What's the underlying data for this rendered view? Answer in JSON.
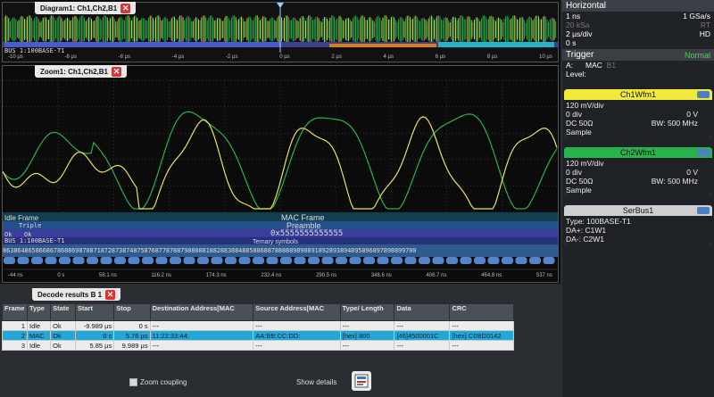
{
  "diagram1": {
    "title": "Diagram1: Ch1,Ch2,B1",
    "bus_label": "BUS 1:100BASE-T1",
    "ticks": [
      "-10 µs",
      "-8 µs",
      "-6 µs",
      "-4 µs",
      "-2 µs",
      "0 µs",
      "2 µs",
      "4 µs",
      "6 µs",
      "8 µs",
      "10 µs"
    ]
  },
  "zoom1": {
    "title": "Zoom1: Ch1,Ch2,B1",
    "frame_idle": "Idle Frame",
    "triple": "Triple",
    "ok1": "Ok",
    "ok2": "Ok",
    "mac_frame": "MAC Frame",
    "preamble": "Preamble",
    "preamble_value": "0x5555555555555",
    "bus_label": "BUS 1:100BASE-T1",
    "ternary": "Ternary symbols",
    "ternary_row": "863864865866867868869870871872873874875876877878879880881882883884885886887888889890891892893894895896897898899700",
    "ticks": [
      "-44 ns",
      "0 s",
      "58.1 ns",
      "116.2 ns",
      "174.3 ns",
      "232.4 ns",
      "290.5 ns",
      "348.6 ns",
      "406.7 ns",
      "464.8 ns",
      "537 ns"
    ]
  },
  "decode": {
    "title": "Decode results B 1",
    "headers": [
      "Frame",
      "Type",
      "State",
      "Start",
      "Stop",
      "Destination Address[MAC",
      "Source Address[MAC",
      "Type/ Length",
      "Data",
      "CRC"
    ],
    "rows": [
      [
        "1",
        "Idle",
        "Ok",
        "-9.989 µs",
        "0 s",
        "---",
        "---",
        "---",
        "---",
        "---"
      ],
      [
        "2",
        "MAC",
        "Ok",
        "0 s",
        "5.76 µs",
        "11:22:33:44:",
        "AA:BB:CC:DD:",
        "[hex] 800",
        "[46]4500001C",
        "[hex] C0BD0142"
      ],
      [
        "3",
        "Idle",
        "Ok",
        "5.85 µs",
        "9.989 µs",
        "---",
        "---",
        "---",
        "---",
        "---"
      ]
    ],
    "zoom_coupling": "Zoom coupling",
    "show_details": "Show details"
  },
  "horizontal": {
    "title": "Horizontal",
    "rows": [
      {
        "left": "1 ns",
        "right": "1 GSa/s",
        "dim": false
      },
      {
        "left": "20 kSa",
        "right": "RT",
        "dim": true
      },
      {
        "left": "2 µs/div",
        "right": "HD",
        "dim": false
      },
      {
        "left": "0 s",
        "right": "",
        "dim": false
      }
    ]
  },
  "trigger": {
    "title": "Trigger",
    "mode": "Normal",
    "a_label": "A:",
    "a_type": "MAC",
    "a_src": "B1",
    "level_label": "Level:"
  },
  "ch1": {
    "title": "Ch1Wfm1",
    "scale": "120 mV/div",
    "offset": "0 div",
    "volt": "0 V",
    "coupling": "DC 50Ω",
    "bw": "BW: 500 MHz",
    "mode": "Sample",
    "color": "#f2ea3a"
  },
  "ch2": {
    "title": "Ch2Wfm1",
    "scale": "120 mV/div",
    "offset": "0 div",
    "volt": "0 V",
    "coupling": "DC 50Ω",
    "bw": "BW: 500 MHz",
    "mode": "Sample",
    "color": "#27b34a"
  },
  "serbus": {
    "title": "SerBus1",
    "type": "Type: 100BASE-T1",
    "da_plus": "DA+: C1W1",
    "da_minus": "DA-: C2W1"
  }
}
